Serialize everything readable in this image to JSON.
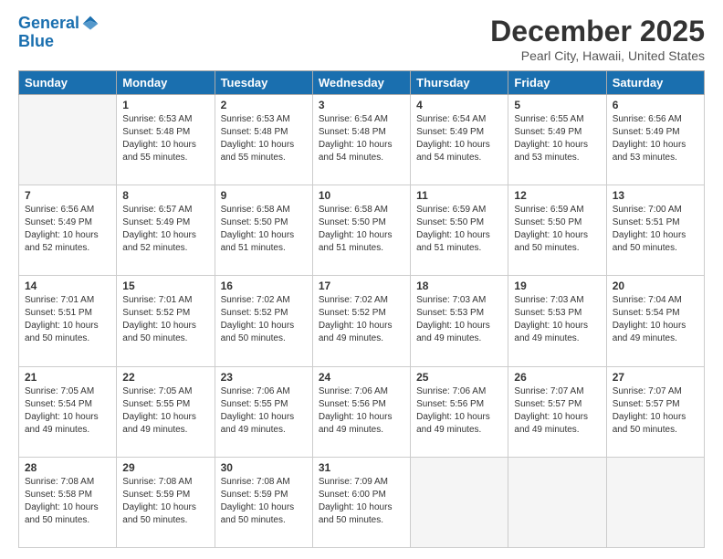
{
  "header": {
    "logo_line1": "General",
    "logo_line2": "Blue",
    "month_title": "December 2025",
    "location": "Pearl City, Hawaii, United States"
  },
  "weekdays": [
    "Sunday",
    "Monday",
    "Tuesday",
    "Wednesday",
    "Thursday",
    "Friday",
    "Saturday"
  ],
  "weeks": [
    [
      {
        "day": "",
        "info": ""
      },
      {
        "day": "1",
        "info": "Sunrise: 6:53 AM\nSunset: 5:48 PM\nDaylight: 10 hours\nand 55 minutes."
      },
      {
        "day": "2",
        "info": "Sunrise: 6:53 AM\nSunset: 5:48 PM\nDaylight: 10 hours\nand 55 minutes."
      },
      {
        "day": "3",
        "info": "Sunrise: 6:54 AM\nSunset: 5:48 PM\nDaylight: 10 hours\nand 54 minutes."
      },
      {
        "day": "4",
        "info": "Sunrise: 6:54 AM\nSunset: 5:49 PM\nDaylight: 10 hours\nand 54 minutes."
      },
      {
        "day": "5",
        "info": "Sunrise: 6:55 AM\nSunset: 5:49 PM\nDaylight: 10 hours\nand 53 minutes."
      },
      {
        "day": "6",
        "info": "Sunrise: 6:56 AM\nSunset: 5:49 PM\nDaylight: 10 hours\nand 53 minutes."
      }
    ],
    [
      {
        "day": "7",
        "info": "Sunrise: 6:56 AM\nSunset: 5:49 PM\nDaylight: 10 hours\nand 52 minutes."
      },
      {
        "day": "8",
        "info": "Sunrise: 6:57 AM\nSunset: 5:49 PM\nDaylight: 10 hours\nand 52 minutes."
      },
      {
        "day": "9",
        "info": "Sunrise: 6:58 AM\nSunset: 5:50 PM\nDaylight: 10 hours\nand 51 minutes."
      },
      {
        "day": "10",
        "info": "Sunrise: 6:58 AM\nSunset: 5:50 PM\nDaylight: 10 hours\nand 51 minutes."
      },
      {
        "day": "11",
        "info": "Sunrise: 6:59 AM\nSunset: 5:50 PM\nDaylight: 10 hours\nand 51 minutes."
      },
      {
        "day": "12",
        "info": "Sunrise: 6:59 AM\nSunset: 5:50 PM\nDaylight: 10 hours\nand 50 minutes."
      },
      {
        "day": "13",
        "info": "Sunrise: 7:00 AM\nSunset: 5:51 PM\nDaylight: 10 hours\nand 50 minutes."
      }
    ],
    [
      {
        "day": "14",
        "info": "Sunrise: 7:01 AM\nSunset: 5:51 PM\nDaylight: 10 hours\nand 50 minutes."
      },
      {
        "day": "15",
        "info": "Sunrise: 7:01 AM\nSunset: 5:52 PM\nDaylight: 10 hours\nand 50 minutes."
      },
      {
        "day": "16",
        "info": "Sunrise: 7:02 AM\nSunset: 5:52 PM\nDaylight: 10 hours\nand 50 minutes."
      },
      {
        "day": "17",
        "info": "Sunrise: 7:02 AM\nSunset: 5:52 PM\nDaylight: 10 hours\nand 49 minutes."
      },
      {
        "day": "18",
        "info": "Sunrise: 7:03 AM\nSunset: 5:53 PM\nDaylight: 10 hours\nand 49 minutes."
      },
      {
        "day": "19",
        "info": "Sunrise: 7:03 AM\nSunset: 5:53 PM\nDaylight: 10 hours\nand 49 minutes."
      },
      {
        "day": "20",
        "info": "Sunrise: 7:04 AM\nSunset: 5:54 PM\nDaylight: 10 hours\nand 49 minutes."
      }
    ],
    [
      {
        "day": "21",
        "info": "Sunrise: 7:05 AM\nSunset: 5:54 PM\nDaylight: 10 hours\nand 49 minutes."
      },
      {
        "day": "22",
        "info": "Sunrise: 7:05 AM\nSunset: 5:55 PM\nDaylight: 10 hours\nand 49 minutes."
      },
      {
        "day": "23",
        "info": "Sunrise: 7:06 AM\nSunset: 5:55 PM\nDaylight: 10 hours\nand 49 minutes."
      },
      {
        "day": "24",
        "info": "Sunrise: 7:06 AM\nSunset: 5:56 PM\nDaylight: 10 hours\nand 49 minutes."
      },
      {
        "day": "25",
        "info": "Sunrise: 7:06 AM\nSunset: 5:56 PM\nDaylight: 10 hours\nand 49 minutes."
      },
      {
        "day": "26",
        "info": "Sunrise: 7:07 AM\nSunset: 5:57 PM\nDaylight: 10 hours\nand 49 minutes."
      },
      {
        "day": "27",
        "info": "Sunrise: 7:07 AM\nSunset: 5:57 PM\nDaylight: 10 hours\nand 50 minutes."
      }
    ],
    [
      {
        "day": "28",
        "info": "Sunrise: 7:08 AM\nSunset: 5:58 PM\nDaylight: 10 hours\nand 50 minutes."
      },
      {
        "day": "29",
        "info": "Sunrise: 7:08 AM\nSunset: 5:59 PM\nDaylight: 10 hours\nand 50 minutes."
      },
      {
        "day": "30",
        "info": "Sunrise: 7:08 AM\nSunset: 5:59 PM\nDaylight: 10 hours\nand 50 minutes."
      },
      {
        "day": "31",
        "info": "Sunrise: 7:09 AM\nSunset: 6:00 PM\nDaylight: 10 hours\nand 50 minutes."
      },
      {
        "day": "",
        "info": ""
      },
      {
        "day": "",
        "info": ""
      },
      {
        "day": "",
        "info": ""
      }
    ]
  ]
}
